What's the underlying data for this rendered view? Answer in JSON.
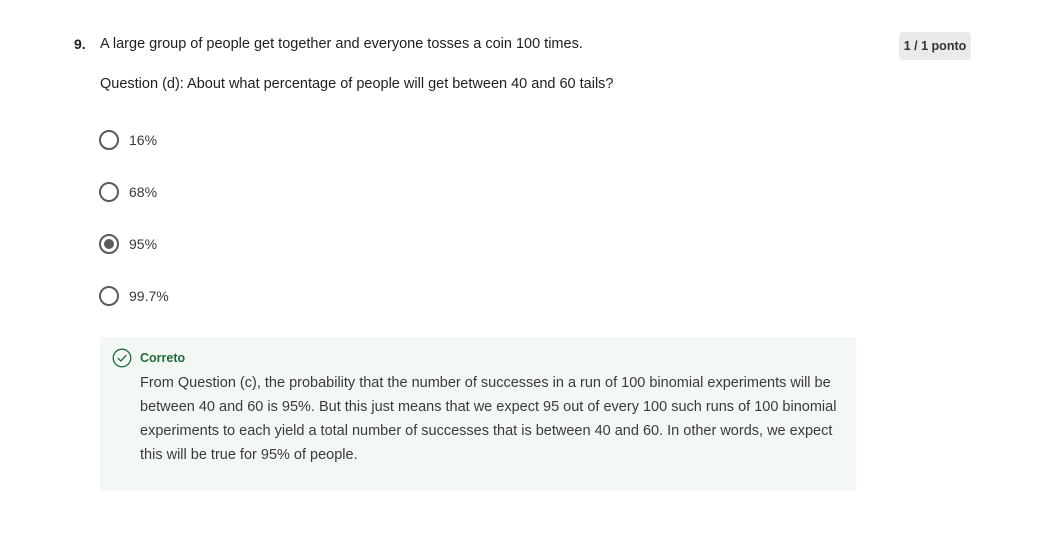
{
  "question": {
    "number": "9.",
    "prompt": "A large group of people get together and everyone tosses a coin 100 times.",
    "subquestion": "Question (d): About what percentage of people will get between 40 and 60 tails?",
    "score": "1 / 1 ponto"
  },
  "options": [
    {
      "label": "16%",
      "selected": false
    },
    {
      "label": "68%",
      "selected": false
    },
    {
      "label": "95%",
      "selected": true
    },
    {
      "label": "99.7%",
      "selected": false
    }
  ],
  "feedback": {
    "status": "Correto",
    "icon": "check-circle-icon",
    "color": "#1f6b3c",
    "text": "From Question (c), the probability that the number of successes in a run of 100 binomial experiments will be between 40 and 60 is 95%.  But this just means that we expect 95 out of every 100 such runs of 100 binomial experiments to each yield a total number of successes that is between 40 and 60.  In other words, we expect this will be true for 95% of people."
  }
}
